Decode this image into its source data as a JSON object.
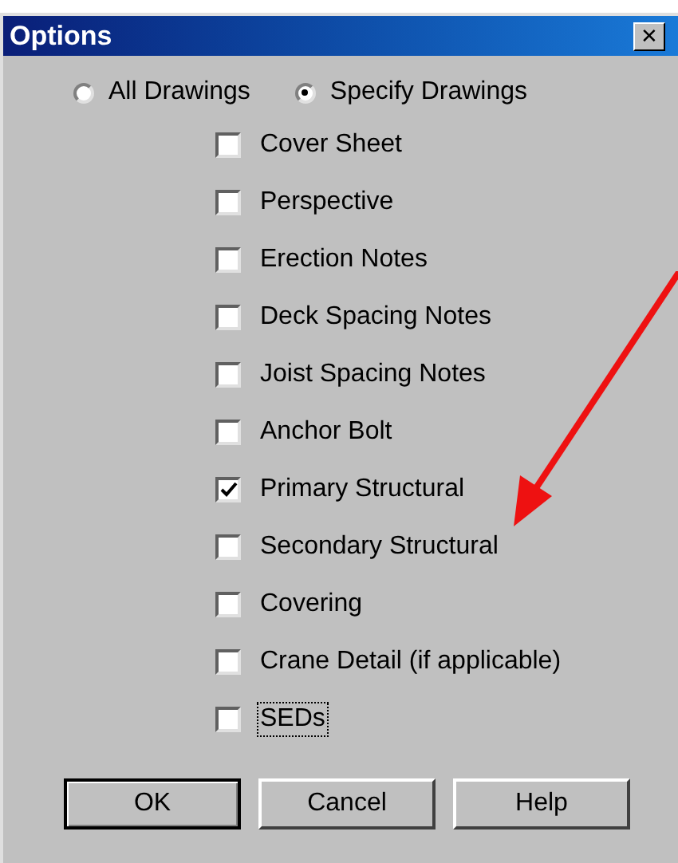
{
  "window": {
    "title": "Options",
    "close": "✕"
  },
  "radios": [
    {
      "label": "All Drawings",
      "selected": false
    },
    {
      "label": "Specify Drawings",
      "selected": true
    }
  ],
  "checkboxes": [
    {
      "label": "Cover Sheet",
      "checked": false,
      "focused": false
    },
    {
      "label": "Perspective",
      "checked": false,
      "focused": false
    },
    {
      "label": "Erection Notes",
      "checked": false,
      "focused": false
    },
    {
      "label": "Deck Spacing Notes",
      "checked": false,
      "focused": false
    },
    {
      "label": "Joist Spacing Notes",
      "checked": false,
      "focused": false
    },
    {
      "label": "Anchor Bolt",
      "checked": false,
      "focused": false
    },
    {
      "label": "Primary Structural",
      "checked": true,
      "focused": false
    },
    {
      "label": "Secondary Structural",
      "checked": false,
      "focused": false
    },
    {
      "label": "Covering",
      "checked": false,
      "focused": false
    },
    {
      "label": "Crane Detail (if applicable)",
      "checked": false,
      "focused": false
    },
    {
      "label": "SEDs",
      "checked": false,
      "focused": true
    }
  ],
  "buttons": [
    {
      "label": "OK",
      "default": true
    },
    {
      "label": "Cancel",
      "default": false
    },
    {
      "label": "Help",
      "default": false
    }
  ]
}
